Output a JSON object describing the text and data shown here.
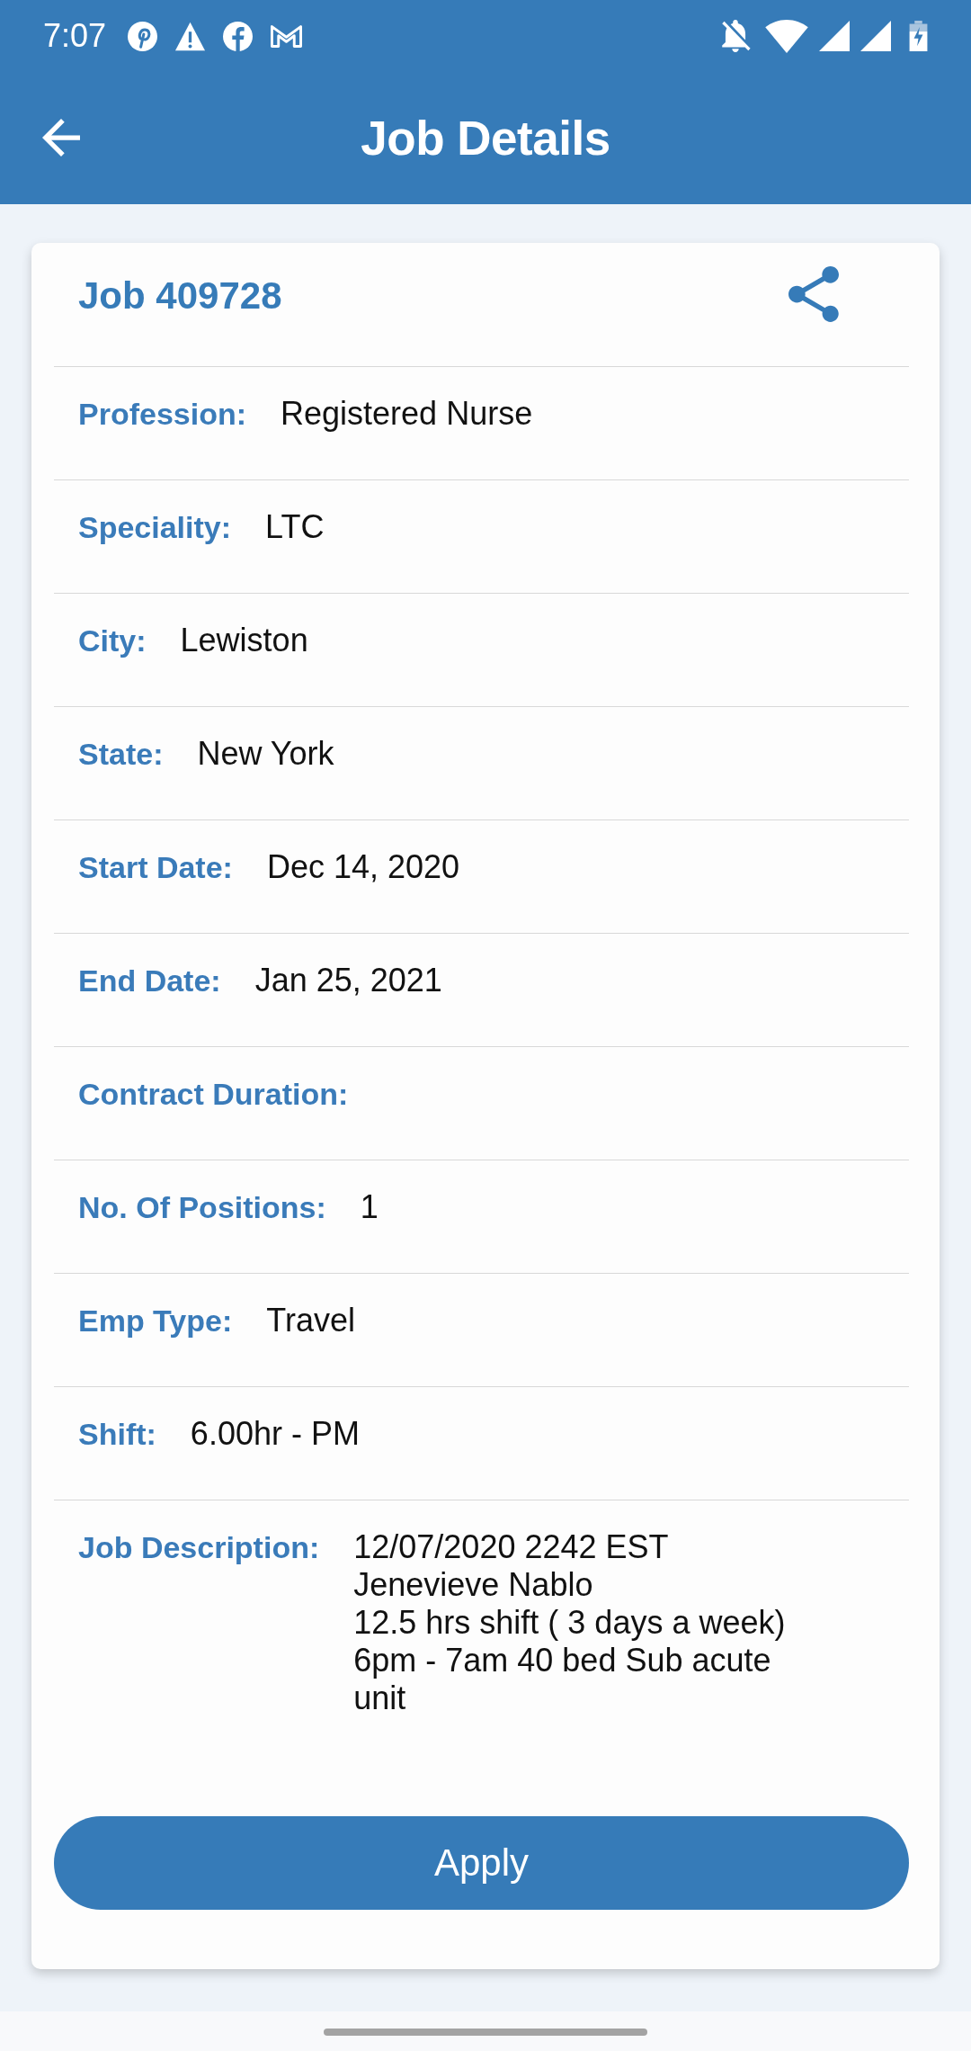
{
  "status_bar": {
    "time": "7:07"
  },
  "app_bar": {
    "title": "Job Details"
  },
  "job": {
    "title": "Job 409728",
    "fields": [
      {
        "label": "Profession:",
        "value": "Registered Nurse"
      },
      {
        "label": "Speciality:",
        "value": "LTC"
      },
      {
        "label": "City:",
        "value": "Lewiston"
      },
      {
        "label": "State:",
        "value": "New York"
      },
      {
        "label": "Start Date:",
        "value": "Dec 14, 2020"
      },
      {
        "label": "End Date:",
        "value": "Jan 25, 2021"
      },
      {
        "label": "Contract Duration:"
      },
      {
        "label": "No. Of Positions:",
        "value": "1"
      },
      {
        "label": "Emp Type:",
        "value": "Travel"
      },
      {
        "label": "Shift:",
        "value": "6.00hr - PM"
      },
      {
        "label": "Job Description:",
        "value": "12/07/2020 2242 EST\nJenevieve Nablo\n12.5 hrs shift ( 3 days a week)\n6pm - 7am 40 bed Sub acute unit"
      }
    ]
  },
  "apply_button": {
    "label": "Apply"
  }
}
